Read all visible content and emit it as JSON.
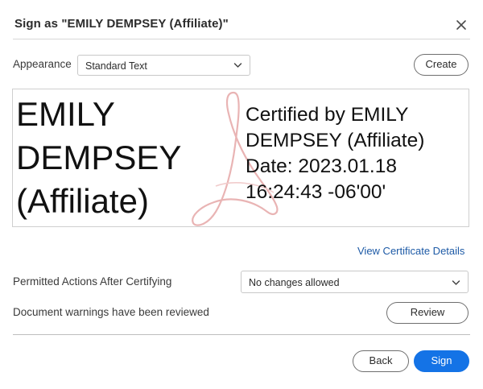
{
  "dialog": {
    "title": "Sign as \"EMILY DEMPSEY (Affiliate)\"",
    "close_icon": "close-icon"
  },
  "appearance": {
    "label": "Appearance",
    "selected": "Standard Text",
    "create_label": "Create"
  },
  "preview": {
    "name_lines": [
      "EMILY",
      "DEMPSEY",
      "(Affiliate)"
    ],
    "cert_lines": [
      "Certified by EMILY",
      "DEMPSEY (Affiliate)",
      "Date: 2023.01.18",
      "16:24:43 -06'00'"
    ],
    "watermark_icon": "acrobat-logo-icon"
  },
  "certificate": {
    "link_label": "View Certificate Details"
  },
  "permitted": {
    "label": "Permitted Actions After Certifying",
    "selected": "No changes allowed"
  },
  "warnings": {
    "label": "Document warnings have been reviewed",
    "review_label": "Review"
  },
  "footer": {
    "back_label": "Back",
    "sign_label": "Sign"
  },
  "colors": {
    "accent": "#1473e6",
    "link": "#1d5aa6",
    "watermark": "#e9b4b4"
  }
}
